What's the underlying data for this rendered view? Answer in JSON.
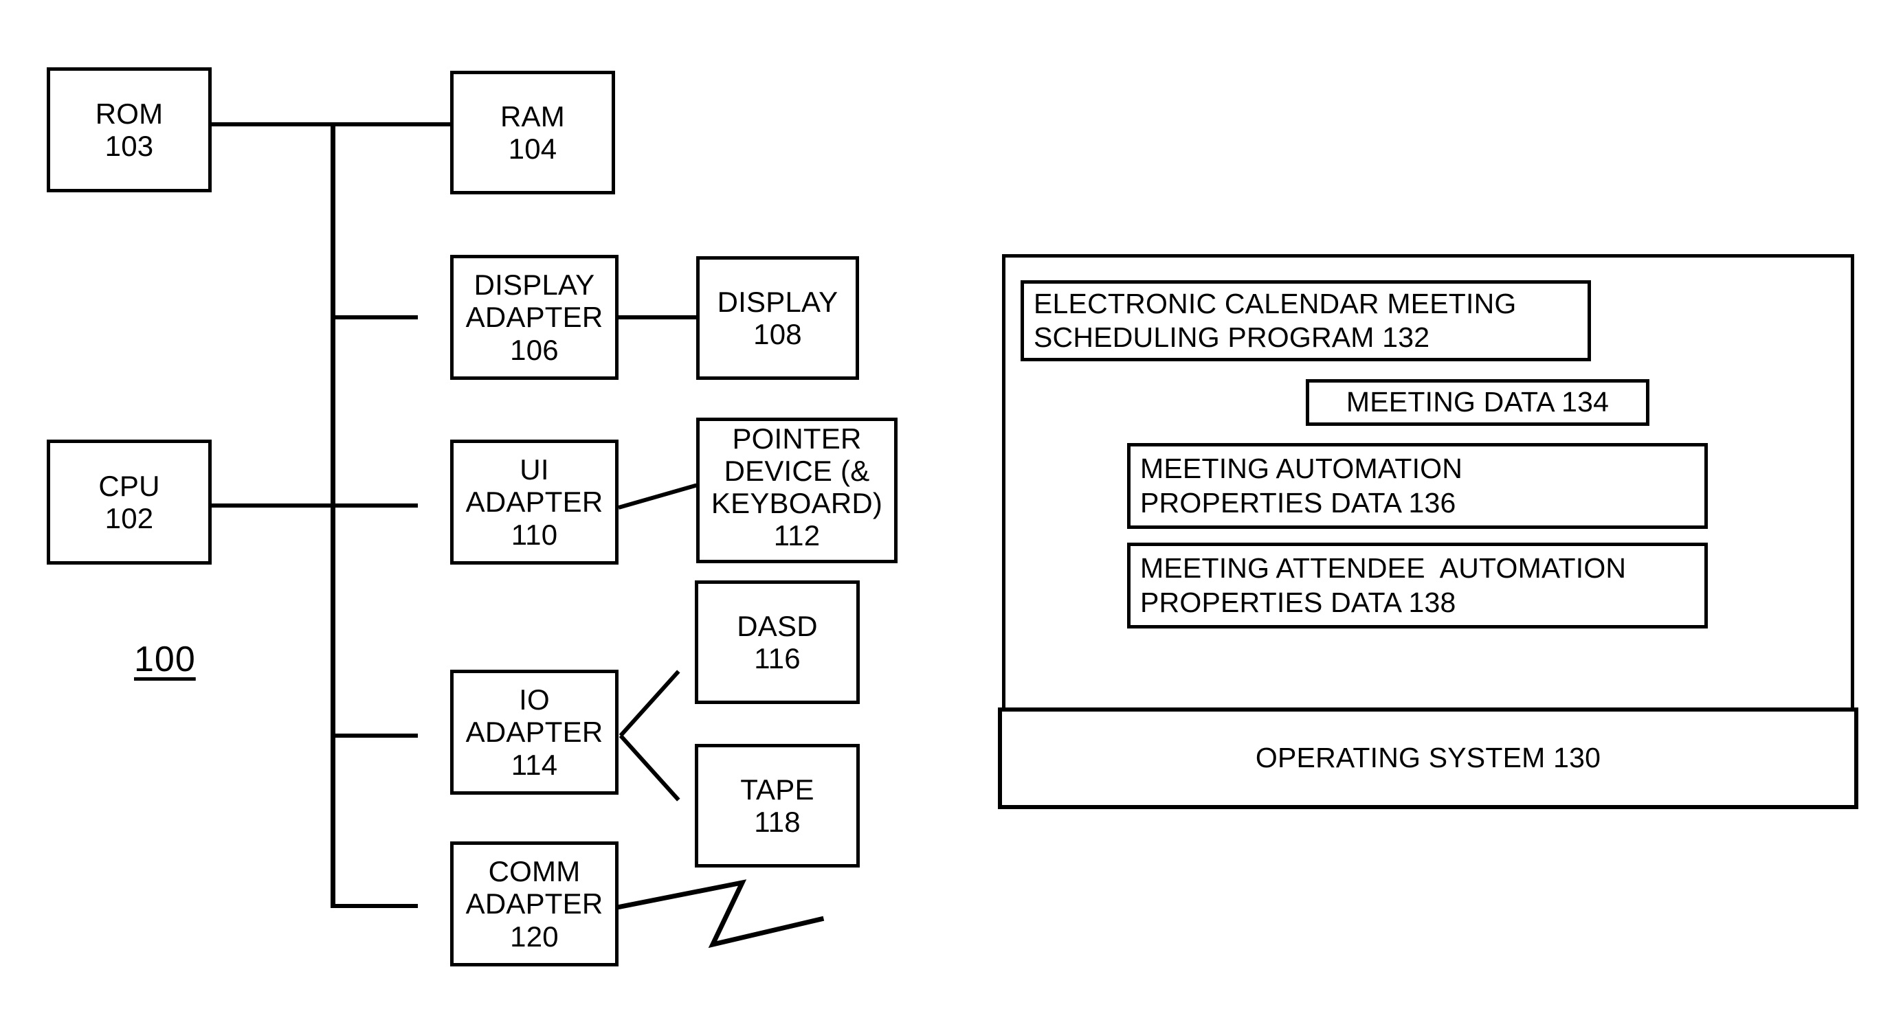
{
  "figure": {
    "reference_numeral": "100",
    "left_hardware_blocks": [
      {
        "id": "rom",
        "lines": [
          "ROM",
          "103"
        ]
      },
      {
        "id": "ram",
        "lines": [
          "RAM",
          "104"
        ]
      },
      {
        "id": "display-adapter",
        "lines": [
          "DISPLAY",
          "ADAPTER",
          "106"
        ]
      },
      {
        "id": "display",
        "lines": [
          "DISPLAY",
          "108"
        ]
      },
      {
        "id": "cpu",
        "lines": [
          "CPU",
          "102"
        ]
      },
      {
        "id": "ui-adapter",
        "lines": [
          "UI",
          "ADAPTER",
          "110"
        ]
      },
      {
        "id": "pointer-device",
        "lines": [
          "POINTER",
          "DEVICE (&",
          "KEYBOARD)",
          "112"
        ]
      },
      {
        "id": "io-adapter",
        "lines": [
          "IO",
          "ADAPTER",
          "114"
        ]
      },
      {
        "id": "dasd",
        "lines": [
          "DASD",
          "116"
        ]
      },
      {
        "id": "tape",
        "lines": [
          "TAPE",
          "118"
        ]
      },
      {
        "id": "comm-adapter",
        "lines": [
          "COMM",
          "ADAPTER",
          "120"
        ]
      }
    ],
    "memory_panel": {
      "program_box": {
        "lines": [
          "ELECTRONIC CALENDAR MEETING",
          "SCHEDULING PROGRAM 132"
        ]
      },
      "meeting_data": {
        "lines": [
          "MEETING DATA 134"
        ]
      },
      "automation": {
        "lines": [
          "MEETING AUTOMATION",
          "PROPERTIES DATA 136"
        ]
      },
      "attendee": {
        "lines": [
          "MEETING ATTENDEE  AUTOMATION",
          "PROPERTIES DATA 138"
        ]
      },
      "operating_system": {
        "lines": [
          "OPERATING SYSTEM 130"
        ]
      }
    },
    "icons": {
      "comm_link": "lightning-bolt-network-icon"
    },
    "colors": {
      "ink": "#000000",
      "paper": "#ffffff"
    }
  }
}
